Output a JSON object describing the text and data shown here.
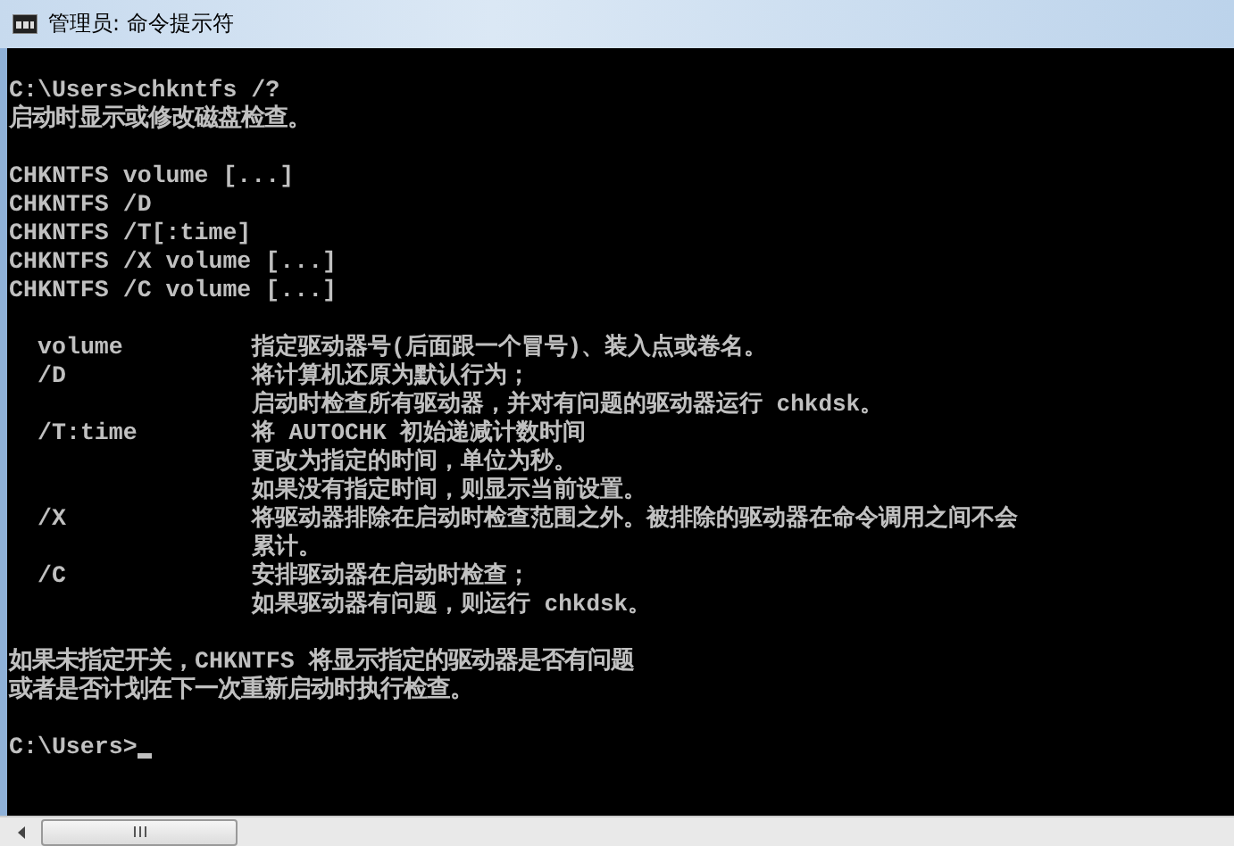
{
  "window": {
    "title": "管理员: 命令提示符"
  },
  "console": {
    "lines": [
      {
        "kind": "blank"
      },
      {
        "kind": "text",
        "text": "C:\\Users>chkntfs /?"
      },
      {
        "kind": "text",
        "text": "启动时显示或修改磁盘检查。"
      },
      {
        "kind": "blank"
      },
      {
        "kind": "text",
        "text": "CHKNTFS volume [...]"
      },
      {
        "kind": "text",
        "text": "CHKNTFS /D"
      },
      {
        "kind": "text",
        "text": "CHKNTFS /T[:time]"
      },
      {
        "kind": "text",
        "text": "CHKNTFS /X volume [...]"
      },
      {
        "kind": "text",
        "text": "CHKNTFS /C volume [...]"
      },
      {
        "kind": "blank"
      },
      {
        "kind": "option",
        "option": "volume",
        "description": "指定驱动器号(后面跟一个冒号)、装入点或卷名。"
      },
      {
        "kind": "option",
        "option": "/D",
        "description": "将计算机还原为默认行为；"
      },
      {
        "kind": "continuation",
        "description": "启动时检查所有驱动器，并对有问题的驱动器运行 chkdsk。"
      },
      {
        "kind": "option",
        "option": "/T:time",
        "description": "将 AUTOCHK 初始递减计数时间"
      },
      {
        "kind": "continuation",
        "description": "更改为指定的时间，单位为秒。"
      },
      {
        "kind": "continuation",
        "description": "如果没有指定时间，则显示当前设置。"
      },
      {
        "kind": "option",
        "option": "/X",
        "description": "将驱动器排除在启动时检查范围之外。被排除的驱动器在命令调用之间不会"
      },
      {
        "kind": "continuation",
        "description": "累计。"
      },
      {
        "kind": "option",
        "option": "/C",
        "description": "安排驱动器在启动时检查；"
      },
      {
        "kind": "continuation",
        "description": "如果驱动器有问题，则运行 chkdsk。"
      },
      {
        "kind": "blank"
      },
      {
        "kind": "text",
        "text": "如果未指定开关，CHKNTFS 将显示指定的驱动器是否有问题"
      },
      {
        "kind": "text",
        "text": "或者是否计划在下一次重新启动时执行检查。"
      },
      {
        "kind": "blank"
      },
      {
        "kind": "prompt",
        "text": "C:\\Users>",
        "cursor": true
      }
    ]
  }
}
